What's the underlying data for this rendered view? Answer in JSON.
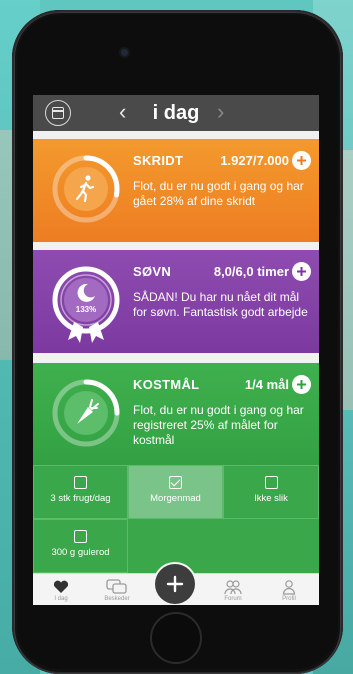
{
  "header": {
    "title": "i dag",
    "prev_icon": "chevron-left-icon",
    "next_icon": "chevron-right-icon",
    "calendar_icon": "calendar-icon"
  },
  "cards": {
    "steps": {
      "label": "SKRIDT",
      "value": "1.927/7.000",
      "progress": 0.28,
      "text": "Flot, du er nu godt i gang og har gået 28% af dine skridt",
      "color": "#f08a27",
      "icon": "walking-person-icon"
    },
    "sleep": {
      "label": "SØVN",
      "value": "8,0/6,0 timer",
      "badge": "133%",
      "text": "SÅDAN! Du har nu nået dit mål for søvn. Fantastisk godt arbejde",
      "color": "#8444a8",
      "icon": "moon-icon"
    },
    "diet": {
      "label": "KOSTMÅL",
      "value": "1/4 mål",
      "progress": 0.25,
      "text": "Flot, du er nu godt i gang og har registreret 25% af målet for kostmål",
      "color": "#37a647",
      "icon": "carrot-icon"
    }
  },
  "goals": [
    {
      "label": "3 stk frugt/dag",
      "checked": false
    },
    {
      "label": "Morgenmad",
      "checked": true
    },
    {
      "label": "Ikke slik",
      "checked": false
    },
    {
      "label": "300 g gulerod",
      "checked": false
    }
  ],
  "tabbar": {
    "items": [
      {
        "label": "I dag",
        "icon": "heart-icon"
      },
      {
        "label": "Beskeder",
        "icon": "chat-icon"
      },
      {
        "label": "Forum",
        "icon": "group-icon"
      },
      {
        "label": "Profil",
        "icon": "person-icon"
      }
    ],
    "add_icon": "plus-icon"
  }
}
